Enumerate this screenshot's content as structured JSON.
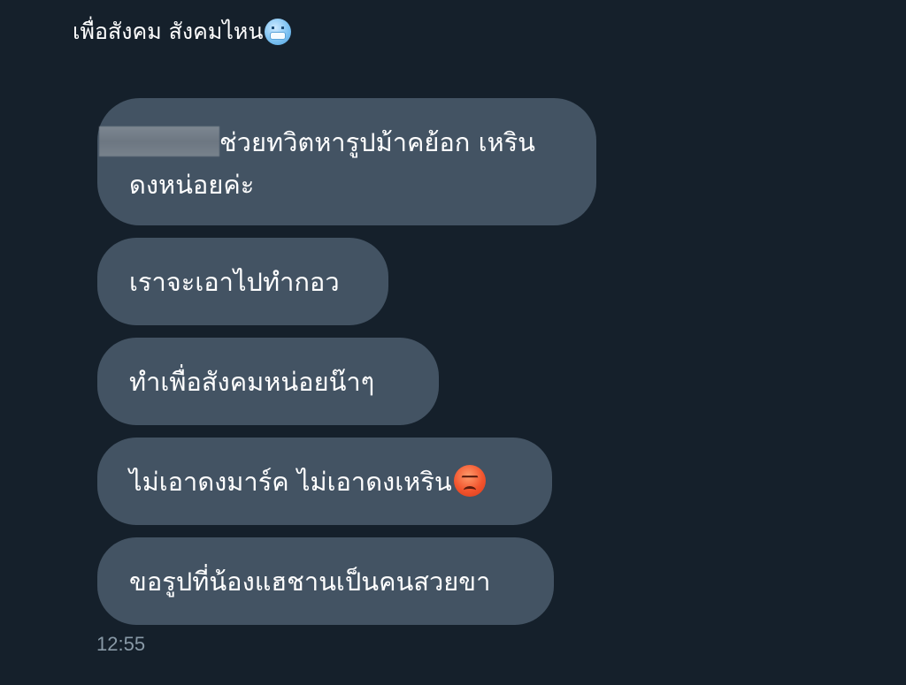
{
  "post": {
    "caption_text": "เพื่อสังคม สังคมไหน",
    "caption_emoji": "cold-face-emoji"
  },
  "chat": {
    "messages": [
      {
        "line1": "ช่วยทวิตหารูปม้าคย้อก เหริน",
        "line2": "ดงหน่อยค่ะ",
        "redacted_prefix": true
      },
      {
        "text": "เราจะเอาไปทำกอว"
      },
      {
        "text": "ทำเพื่อสังคมหน่อยน๊าๆ"
      },
      {
        "text": "ไม่เอาดงมาร์ค ไม่เอาดงเหริน",
        "emoji": "angry-face-emoji"
      },
      {
        "text": "ขอรูปที่น้องแฮชานเป็นคนสวยขา"
      }
    ],
    "timestamp": "12:55"
  },
  "colors": {
    "background": "#15202b",
    "bubble": "#435363",
    "text": "#ffffff",
    "timestamp": "#8899a6"
  }
}
